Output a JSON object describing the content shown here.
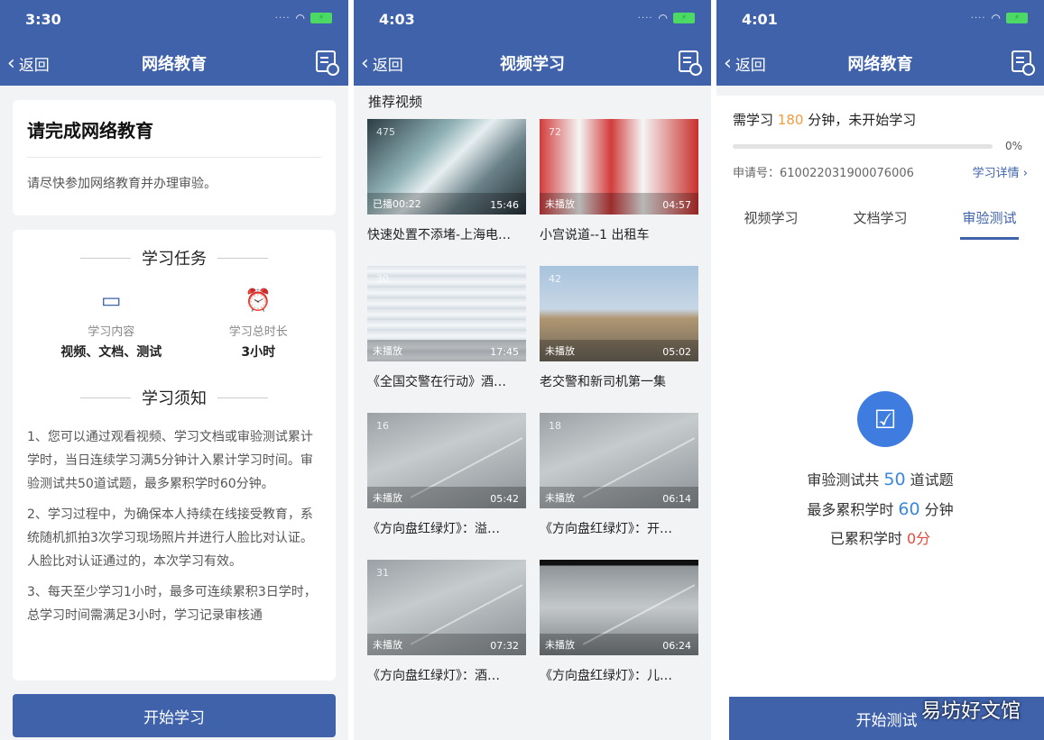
{
  "panel1": {
    "status_time": "3:30",
    "back_label": "返回",
    "nav_title": "网络教育",
    "card_title": "请完成网络教育",
    "card_subtitle": "请尽快参加网络教育并办理审验。",
    "section_task": "学习任务",
    "stat1_label": "学习内容",
    "stat1_value": "视频、文档、测试",
    "stat2_label": "学习总时长",
    "stat2_value": "3小时",
    "section_notice": "学习须知",
    "notice1": "1、您可以通过观看视频、学习文档或审验测试累计学时，当日连续学习满5分钟计入累计学习时间。审验测试共50道试题，最多累积学时60分钟。",
    "notice2": "2、学习过程中，为确保本人持续在线接受教育，系统随机抓拍3次学习现场照片并进行人脸比对认证。人脸比对认证通过的，本次学习有效。",
    "notice3": "3、每天至少学习1小时，最多可连续累积3日学时，总学习时间需满足3小时，学习记录审核通",
    "start_button": "开始学习"
  },
  "panel2": {
    "status_time": "4:03",
    "back_label": "返回",
    "nav_title": "视频学习",
    "section_title": "推荐视频",
    "videos": [
      {
        "count": "475",
        "state": "已播00:22",
        "duration": "15:46",
        "title": "快速处置不添堵-上海电…"
      },
      {
        "count": "72",
        "state": "未播放",
        "duration": "04:57",
        "title": "小宫说道--1 出租车"
      },
      {
        "count": "30",
        "state": "未播放",
        "duration": "17:45",
        "title": "《全国交警在行动》酒…"
      },
      {
        "count": "42",
        "state": "未播放",
        "duration": "05:02",
        "title": "老交警和新司机第一集"
      },
      {
        "count": "16",
        "state": "未播放",
        "duration": "05:42",
        "title": "《方向盘红绿灯》：溢…"
      },
      {
        "count": "18",
        "state": "未播放",
        "duration": "06:14",
        "title": "《方向盘红绿灯》：开…"
      },
      {
        "count": "31",
        "state": "未播放",
        "duration": "07:32",
        "title": "《方向盘红绿灯》：酒…"
      },
      {
        "count": "",
        "state": "未播放",
        "duration": "06:24",
        "title": "《方向盘红绿灯》：儿…"
      }
    ]
  },
  "panel3": {
    "status_time": "4:01",
    "back_label": "返回",
    "nav_title": "网络教育",
    "need_prefix": "需学习 ",
    "need_minutes": "180",
    "need_suffix": " 分钟，未开始学习",
    "progress_label": "0%",
    "progress_value": 0,
    "apply_no": "申请号：610022031900076006",
    "detail_link": "学习详情 ›",
    "tabs": [
      "视频学习",
      "文档学习",
      "审验测试"
    ],
    "line1_prefix": "审验测试共 ",
    "line1_num": "50",
    "line1_suffix": " 道试题",
    "line2_prefix": "最多累积学时 ",
    "line2_num": "60",
    "line2_suffix": " 分钟",
    "line3_prefix": "已累积学时 ",
    "line3_num": "0分",
    "start_test_button": "开始测试",
    "watermark": "易坊好文馆"
  },
  "colors": {
    "brand": "#3f62ab",
    "accent_orange": "#f39b3d",
    "accent_blue": "#3a87e0",
    "accent_red": "#e24a3b"
  },
  "icons": [
    "chevron-left-icon",
    "document-clock-icon",
    "book-icon",
    "alarm-clock-icon",
    "clipboard-checklist-icon",
    "play-icon"
  ]
}
